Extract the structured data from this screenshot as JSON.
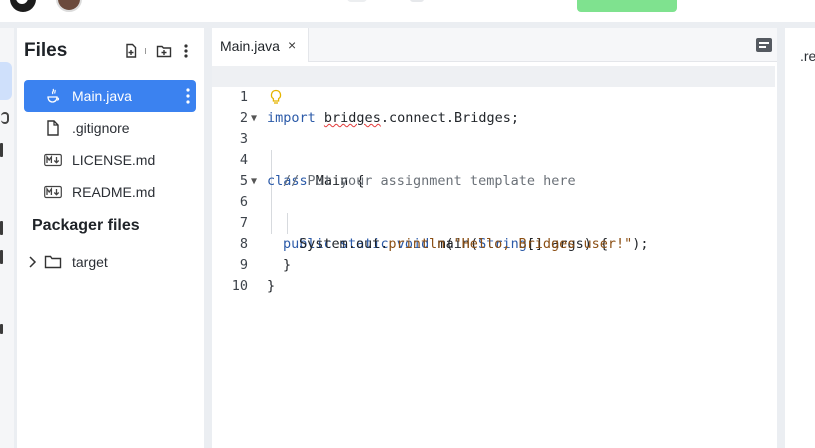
{
  "files_panel": {
    "title": "Files",
    "items": [
      {
        "label": "Main.java",
        "icon": "java-icon",
        "active": true
      },
      {
        "label": ".gitignore",
        "icon": "file-icon",
        "active": false
      },
      {
        "label": "LICENSE.md",
        "icon": "markdown-icon",
        "active": false
      },
      {
        "label": "README.md",
        "icon": "markdown-icon",
        "active": false
      }
    ],
    "packager_title": "Packager files",
    "packager_items": [
      {
        "label": "target",
        "icon": "folder-icon"
      }
    ]
  },
  "editor": {
    "tab_label": "Main.java",
    "tab_close": "×",
    "lines": [
      {
        "n": "1"
      },
      {
        "n": "2"
      },
      {
        "n": "3"
      },
      {
        "n": "4"
      },
      {
        "n": "5"
      },
      {
        "n": "6"
      },
      {
        "n": "7"
      },
      {
        "n": "8"
      },
      {
        "n": "9"
      },
      {
        "n": "10"
      }
    ],
    "code": {
      "l1_kw": "import",
      "l1_pkg": "bridges",
      "l1_rest": ".connect.Bridges;",
      "l3_kw": "class",
      "l3_rest": " Main {",
      "l4_comment": "// Put your assignment template here",
      "l6_kw": "public static void",
      "l6_fn": " main(",
      "l6_type": "String",
      "l6_rest": "[] args) {",
      "l7_obj": "System.out.",
      "l7_fn": "println",
      "l7_open": "(",
      "l7_str": "\"Hello, Bridges user!\"",
      "l7_close": ");",
      "l8": "}",
      "l9": "}"
    }
  },
  "right_panel": {
    "label": ".re"
  }
}
